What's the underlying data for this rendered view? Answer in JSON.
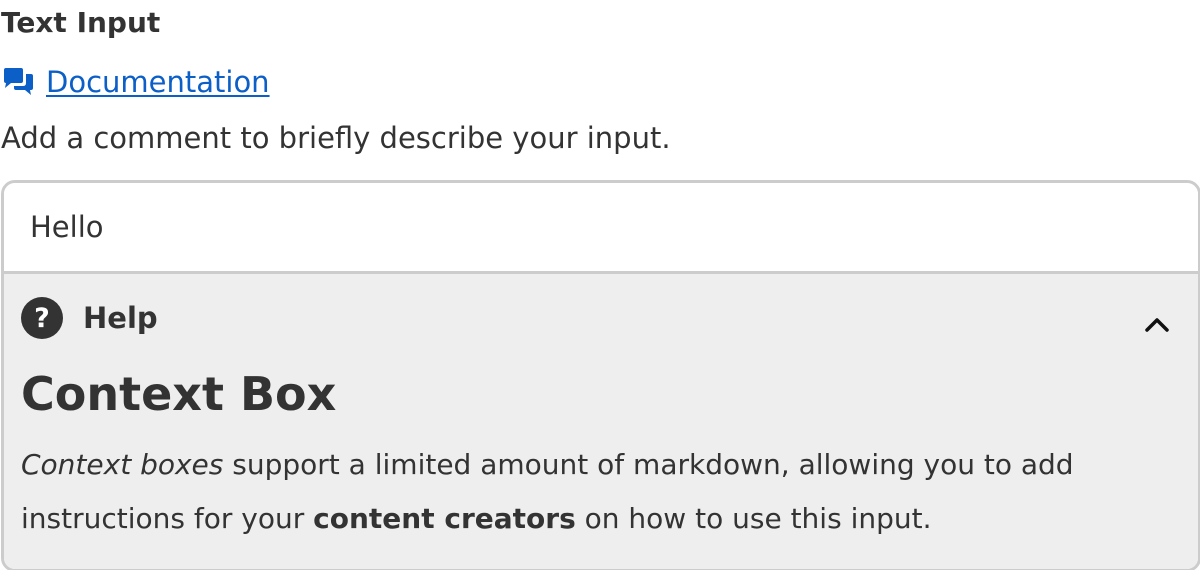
{
  "field": {
    "label": "Text Input",
    "documentation_link": "Documentation",
    "description": "Add a comment to briefly describe your input."
  },
  "input": {
    "value": "Hello"
  },
  "help": {
    "title": "Help",
    "heading": "Context Box",
    "body": {
      "emphasis": "Context boxes",
      "text_1": " support a limited amount of markdown, allowing you to add instructions for your ",
      "strong": "content creators",
      "text_2": " on how to use this input."
    }
  },
  "icons": {
    "documentation": "chat-bubbles-icon",
    "help": "question-circle-icon",
    "collapse": "chevron-up-icon"
  },
  "colors": {
    "link": "#0b5fc7",
    "text": "#333333",
    "panel_background": "#eeeeee",
    "border": "#cccccc"
  }
}
